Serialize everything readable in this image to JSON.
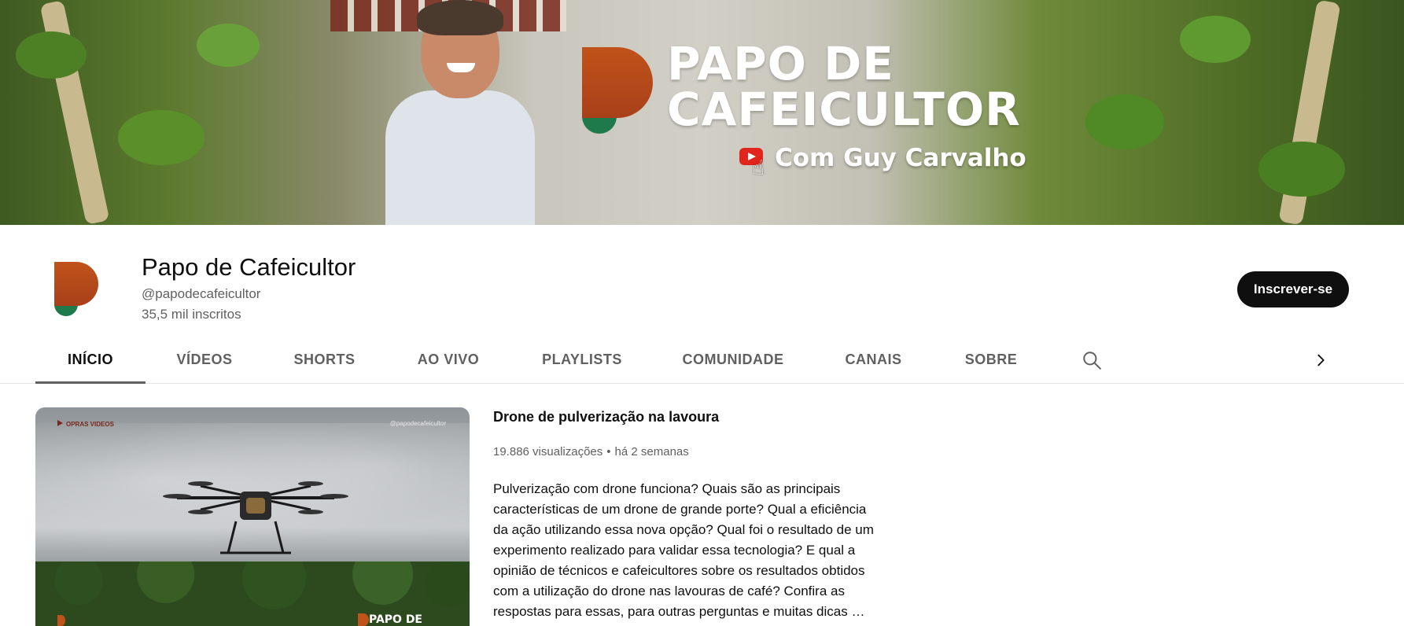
{
  "banner": {
    "title_line1": "PAPO DE",
    "title_line2": "CAFEICULTOR",
    "subtitle": "Com Guy Carvalho"
  },
  "channel": {
    "name": "Papo de Cafeicultor",
    "handle": "@papodecafeicultor",
    "subscribers": "35,5 mil inscritos",
    "subscribe_label": "Inscrever-se"
  },
  "tabs": [
    {
      "label": "INÍCIO",
      "active": true
    },
    {
      "label": "VÍDEOS",
      "active": false
    },
    {
      "label": "SHORTS",
      "active": false
    },
    {
      "label": "AO VIVO",
      "active": false
    },
    {
      "label": "PLAYLISTS",
      "active": false
    },
    {
      "label": "COMUNIDADE",
      "active": false
    },
    {
      "label": "CANAIS",
      "active": false
    },
    {
      "label": "SOBRE",
      "active": false
    }
  ],
  "icons": {
    "search": "search-icon",
    "next": "chevron-right-icon"
  },
  "featured": {
    "thumbnail": {
      "brand": "OPRAS VIDEOS",
      "handle": "@papodecafeicultor",
      "title": "PAPO DE"
    },
    "title": "Drone de pulverização na lavoura",
    "views": "19.886 visualizações",
    "separator": "•",
    "age": "há 2 semanas",
    "description_lines": [
      "Pulverização com drone funciona? Quais são as principais",
      "características de um drone de grande porte? Qual a eficiência",
      "da ação utilizando essa nova opção? Qual foi o resultado de um",
      "experimento realizado para validar essa tecnologia? E qual a",
      "opinião de técnicos e cafeicultores sobre os resultados obtidos",
      "com a utilização do drone nas lavouras de café? Confira as",
      "respostas para essas, para outras perguntas e muitas dicas …"
    ]
  },
  "colors": {
    "brand_orange": "#c0531a",
    "brand_green": "#1e7a4a",
    "subscribe_bg": "#0f0f0f",
    "muted_text": "#606060"
  }
}
